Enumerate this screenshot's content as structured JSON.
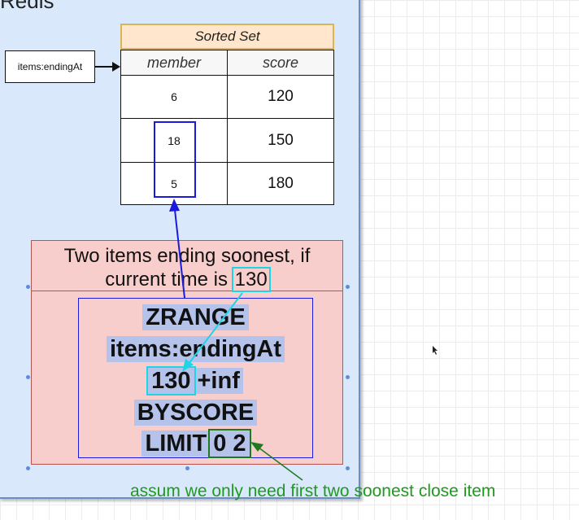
{
  "container": {
    "title": "Redis"
  },
  "key_box": {
    "label": "items:endingAt"
  },
  "sorted_set": {
    "title": "Sorted Set",
    "headers": {
      "member": "member",
      "score": "score"
    },
    "rows": [
      {
        "member": "6",
        "score": "120"
      },
      {
        "member": "18",
        "score": "150"
      },
      {
        "member": "5",
        "score": "180"
      }
    ]
  },
  "note": {
    "line1": "Two items ending soonest, if",
    "line2_prefix": "current time is",
    "current_time": "130"
  },
  "command": {
    "line1": "ZRANGE",
    "line2": "items:endingAt",
    "line3_min": "130",
    "line3_max": "+inf",
    "line4": "BYSCORE",
    "line5_limit": "LIMIT",
    "line5_args": "0 2"
  },
  "annotation": "assum we only need first two soonest close item",
  "colors": {
    "container_fill": "#dae8fc",
    "header_fill": "#ffe6cc",
    "note_fill": "#f8cecc",
    "highlight_blue": "#1a1add",
    "highlight_cyan": "#1fd4e4",
    "annotation_green": "#1f9a1f"
  }
}
